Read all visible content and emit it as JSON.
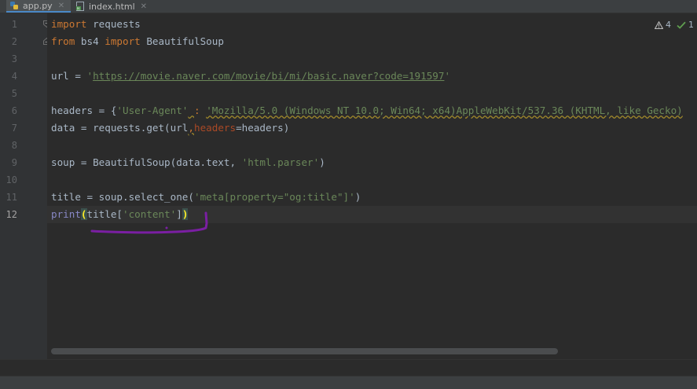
{
  "tabs": [
    {
      "label": "app.py",
      "icon": "python-file-icon",
      "active": true
    },
    {
      "label": "index.html",
      "icon": "html-file-icon",
      "active": false
    }
  ],
  "gutter": {
    "line_numbers": [
      "1",
      "2",
      "3",
      "4",
      "5",
      "6",
      "7",
      "8",
      "9",
      "10",
      "11",
      "12"
    ],
    "current_line": "12"
  },
  "inspections": {
    "warnings": "4",
    "ok": "1"
  },
  "code": {
    "l1": {
      "kw": "import",
      "rest": " requests"
    },
    "l2": {
      "kw1": "from",
      "mid": " bs4 ",
      "kw2": "import",
      "rest": " BeautifulSoup"
    },
    "l4": {
      "pre": "url = ",
      "q1": "'",
      "url": "https://movie.naver.com/movie/bi/mi/basic.naver?code=191597",
      "q2": "'"
    },
    "l6": {
      "pre": "headers = {",
      "key": "'User-Agent'",
      "sp": " ",
      "colon": ":",
      "sp2": " ",
      "val": "'Mozilla/5.0 (Windows NT 10.0; Win64; x64)AppleWebKit/537.36 (KHTML, like Gecko)"
    },
    "l7": {
      "pre": "data = requests.get(url",
      "comma": ",",
      "param": "headers",
      "post": "=headers)"
    },
    "l9": {
      "pre": "soup = BeautifulSoup(data.text, ",
      "str": "'html.parser'",
      "post": ")"
    },
    "l11": {
      "pre": "title = soup.select_one(",
      "str": "'meta[property=\"og:title\"]'",
      "post": ")"
    },
    "l12": {
      "fn": "print",
      "open": "(",
      "mid": "title[",
      "str": "'content'",
      "close1": "]",
      "close2": ")"
    }
  },
  "colors": {
    "editor_bg": "#2b2b2b",
    "keyword": "#cc7832",
    "string": "#6a8759",
    "annotation_stroke": "#7a1fa2"
  }
}
